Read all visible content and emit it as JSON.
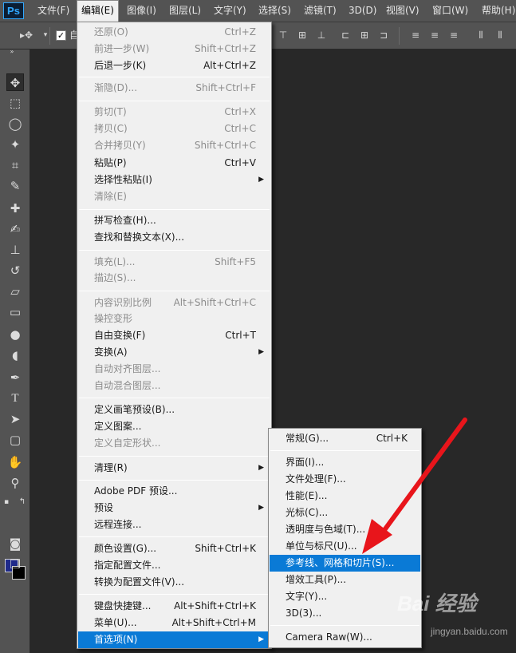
{
  "menubar": {
    "logo": "Ps",
    "items": [
      {
        "label": "文件(F)"
      },
      {
        "label": "编辑(E)"
      },
      {
        "label": "图像(I)"
      },
      {
        "label": "图层(L)"
      },
      {
        "label": "文字(Y)"
      },
      {
        "label": "选择(S)"
      },
      {
        "label": "滤镜(T)"
      },
      {
        "label": "3D(D)"
      },
      {
        "label": "视图(V)"
      },
      {
        "label": "窗口(W)"
      },
      {
        "label": "帮助(H)"
      }
    ],
    "active": "编辑(E)"
  },
  "optionsbar": {
    "tool_icon": "move-tool-icon",
    "autoselect_checked": true,
    "autoselect_label_visible": "自"
  },
  "edit_menu": {
    "items": [
      {
        "label": "还原(O)",
        "shortcut": "Ctrl+Z",
        "enabled": false
      },
      {
        "label": "前进一步(W)",
        "shortcut": "Shift+Ctrl+Z",
        "enabled": false
      },
      {
        "label": "后退一步(K)",
        "shortcut": "Alt+Ctrl+Z",
        "enabled": true
      },
      {
        "label": "渐隐(D)...",
        "shortcut": "Shift+Ctrl+F",
        "enabled": false
      },
      {
        "label": "剪切(T)",
        "shortcut": "Ctrl+X",
        "enabled": false
      },
      {
        "label": "拷贝(C)",
        "shortcut": "Ctrl+C",
        "enabled": false
      },
      {
        "label": "合并拷贝(Y)",
        "shortcut": "Shift+Ctrl+C",
        "enabled": false
      },
      {
        "label": "粘贴(P)",
        "shortcut": "Ctrl+V",
        "enabled": true
      },
      {
        "label": "选择性粘贴(I)",
        "shortcut": "",
        "enabled": true,
        "submenu": true
      },
      {
        "label": "清除(E)",
        "shortcut": "",
        "enabled": false
      },
      {
        "label": "拼写检查(H)...",
        "shortcut": "",
        "enabled": true
      },
      {
        "label": "查找和替换文本(X)...",
        "shortcut": "",
        "enabled": true
      },
      {
        "label": "填充(L)...",
        "shortcut": "Shift+F5",
        "enabled": false
      },
      {
        "label": "描边(S)...",
        "shortcut": "",
        "enabled": false
      },
      {
        "label": "内容识别比例",
        "shortcut": "Alt+Shift+Ctrl+C",
        "enabled": false
      },
      {
        "label": "操控变形",
        "shortcut": "",
        "enabled": false
      },
      {
        "label": "自由变换(F)",
        "shortcut": "Ctrl+T",
        "enabled": true
      },
      {
        "label": "变换(A)",
        "shortcut": "",
        "enabled": true,
        "submenu": true
      },
      {
        "label": "自动对齐图层...",
        "shortcut": "",
        "enabled": false
      },
      {
        "label": "自动混合图层...",
        "shortcut": "",
        "enabled": false
      },
      {
        "label": "定义画笔预设(B)...",
        "shortcut": "",
        "enabled": true
      },
      {
        "label": "定义图案...",
        "shortcut": "",
        "enabled": true
      },
      {
        "label": "定义自定形状...",
        "shortcut": "",
        "enabled": false
      },
      {
        "label": "清理(R)",
        "shortcut": "",
        "enabled": true,
        "submenu": true
      },
      {
        "label": "Adobe PDF 预设...",
        "shortcut": "",
        "enabled": true
      },
      {
        "label": "预设",
        "shortcut": "",
        "enabled": true,
        "submenu": true
      },
      {
        "label": "远程连接...",
        "shortcut": "",
        "enabled": true
      },
      {
        "label": "颜色设置(G)...",
        "shortcut": "Shift+Ctrl+K",
        "enabled": true
      },
      {
        "label": "指定配置文件...",
        "shortcut": "",
        "enabled": true
      },
      {
        "label": "转换为配置文件(V)...",
        "shortcut": "",
        "enabled": true
      },
      {
        "label": "键盘快捷键...",
        "shortcut": "Alt+Shift+Ctrl+K",
        "enabled": true
      },
      {
        "label": "菜单(U)...",
        "shortcut": "Alt+Shift+Ctrl+M",
        "enabled": true
      },
      {
        "label": "首选项(N)",
        "shortcut": "",
        "enabled": true,
        "submenu": true,
        "highlighted": true
      }
    ]
  },
  "preferences_submenu": {
    "items": [
      {
        "label": "常规(G)...",
        "shortcut": "Ctrl+K"
      },
      {
        "label": "界面(I)...",
        "shortcut": ""
      },
      {
        "label": "文件处理(F)...",
        "shortcut": ""
      },
      {
        "label": "性能(E)...",
        "shortcut": ""
      },
      {
        "label": "光标(C)...",
        "shortcut": ""
      },
      {
        "label": "透明度与色域(T)...",
        "shortcut": ""
      },
      {
        "label": "单位与标尺(U)...",
        "shortcut": ""
      },
      {
        "label": "参考线、网格和切片(S)...",
        "shortcut": "",
        "highlighted": true
      },
      {
        "label": "增效工具(P)...",
        "shortcut": ""
      },
      {
        "label": "文字(Y)...",
        "shortcut": ""
      },
      {
        "label": "3D(3)...",
        "shortcut": ""
      },
      {
        "label": "Camera Raw(W)...",
        "shortcut": ""
      }
    ]
  },
  "annotation": {
    "arrow_color": "#e8151b",
    "highlight_color": "#0a7ad6"
  },
  "watermark": {
    "text": "Bai 经验",
    "sub": "jingyan.baidu.com"
  }
}
